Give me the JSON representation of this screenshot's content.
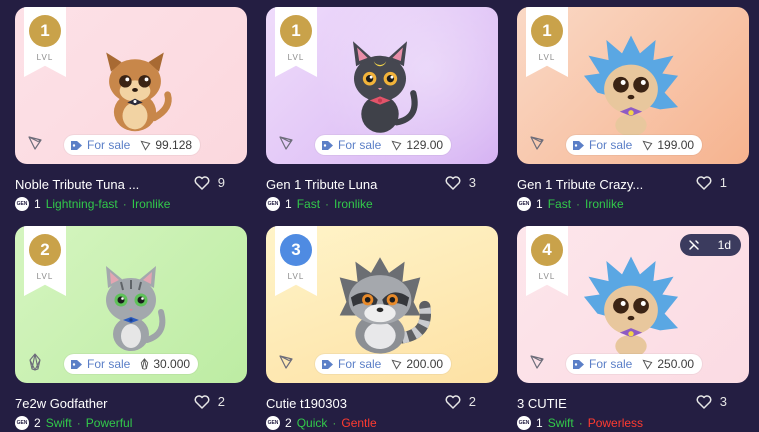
{
  "cards": [
    {
      "level": "1",
      "level_label": "LVL",
      "sale_label": "For sale",
      "price": "99.128",
      "name": "Noble Tribute Tuna ...",
      "likes": "9",
      "gen_badge": "GEN",
      "gen": "1",
      "trait1": "Lightning-fast",
      "trait2": "Ironlike",
      "currency_icon": "tron-icon",
      "pet": "shiba-dog"
    },
    {
      "level": "1",
      "level_label": "LVL",
      "sale_label": "For sale",
      "price": "129.00",
      "name": "Gen 1 Tribute Luna",
      "likes": "3",
      "gen_badge": "GEN",
      "gen": "1",
      "trait1": "Fast",
      "trait2": "Ironlike",
      "currency_icon": "tron-icon",
      "pet": "black-cat"
    },
    {
      "level": "1",
      "level_label": "LVL",
      "sale_label": "For sale",
      "price": "199.00",
      "name": "Gen 1 Tribute Crazy...",
      "likes": "1",
      "gen_badge": "GEN",
      "gen": "1",
      "trait1": "Fast",
      "trait2": "Ironlike",
      "currency_icon": "tron-icon",
      "pet": "blue-hedgehog"
    },
    {
      "level": "2",
      "level_label": "LVL",
      "sale_label": "For sale",
      "price": "30.000",
      "name": "7e2w Godfather",
      "likes": "2",
      "gen_badge": "GEN",
      "gen": "2",
      "trait1": "Swift",
      "trait2": "Powerful",
      "currency_icon": "eos-icon",
      "pet": "gray-cat"
    },
    {
      "level": "3",
      "level_label": "LVL",
      "sale_label": "For sale",
      "price": "200.00",
      "name": "Cutie t190303",
      "likes": "2",
      "gen_badge": "GEN",
      "gen": "2",
      "trait1": "Quick",
      "trait2": "Gentle",
      "currency_icon": "tron-icon",
      "pet": "raccoon"
    },
    {
      "level": "4",
      "level_label": "LVL",
      "sale_label": "For sale",
      "price": "250.00",
      "name": "3 CUTIE",
      "likes": "3",
      "gen_badge": "GEN",
      "gen": "1",
      "trait1": "Swift",
      "trait2": "Powerless",
      "currency_icon": "tron-icon",
      "pet": "blue-hedgehog",
      "timer": "1d"
    }
  ],
  "colors": {
    "background": "#241e42",
    "trait_green": "#32c94a",
    "trait_red": "#ff3b30",
    "sale_blue": "#5b7fc7",
    "level_gold": "#c9a24a",
    "level_blue": "#4f8be2"
  }
}
